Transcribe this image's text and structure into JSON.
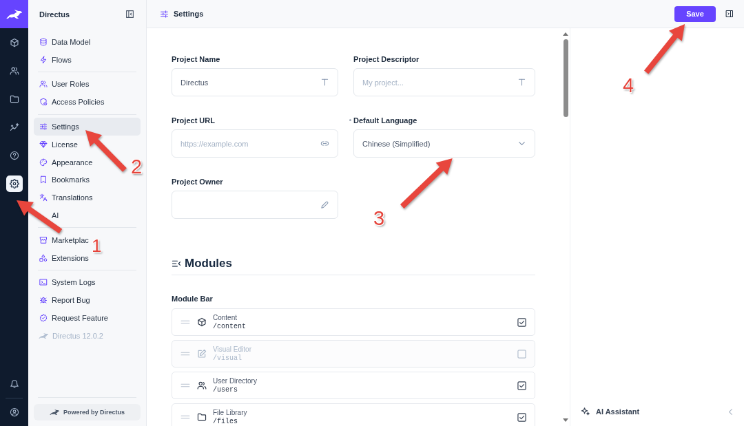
{
  "rail": {
    "items": [
      {
        "kind": "content",
        "selected": false
      },
      {
        "kind": "users",
        "selected": false
      },
      {
        "kind": "files",
        "selected": false
      },
      {
        "kind": "insights",
        "selected": false
      },
      {
        "kind": "help",
        "selected": false
      },
      {
        "kind": "settings",
        "selected": true
      }
    ],
    "bottom": [
      {
        "kind": "notifications"
      },
      {
        "kind": "profile"
      }
    ]
  },
  "sidebar": {
    "title": "Directus",
    "groups": [
      {
        "items": [
          {
            "label": "Data Model",
            "kind": "data-model",
            "selected": false
          },
          {
            "label": "Flows",
            "kind": "flows",
            "selected": false
          }
        ]
      },
      {
        "items": [
          {
            "label": "User Roles",
            "kind": "user-roles",
            "selected": false
          },
          {
            "label": "Access Policies",
            "kind": "access-policies",
            "selected": false
          }
        ]
      },
      {
        "items": [
          {
            "label": "Settings",
            "kind": "settings",
            "selected": true
          },
          {
            "label": "License",
            "kind": "license",
            "selected": false
          },
          {
            "label": "Appearance",
            "kind": "appearance",
            "selected": false
          },
          {
            "label": "Bookmarks",
            "kind": "bookmarks",
            "selected": false
          },
          {
            "label": "Translations",
            "kind": "translations",
            "selected": false
          },
          {
            "label": "AI",
            "selected": false
          }
        ]
      },
      {
        "items": [
          {
            "label": "Marketplac",
            "kind": "marketplace",
            "selected": false
          },
          {
            "label": "Extensions",
            "kind": "extensions",
            "selected": false
          }
        ]
      },
      {
        "items": [
          {
            "label": "System Logs",
            "kind": "system-logs",
            "selected": false
          },
          {
            "label": "Report Bug",
            "kind": "report-bug",
            "selected": false
          },
          {
            "label": "Request Feature",
            "kind": "request-feature",
            "selected": false
          },
          {
            "label": "Directus 12.0.2",
            "kind": "version",
            "selected": false
          }
        ]
      }
    ],
    "footer": "Powered by Directus"
  },
  "header": {
    "title": "Settings",
    "save_button": "Save"
  },
  "form": {
    "fields": [
      {
        "label": "Project Name",
        "kind": "text",
        "value": "Directus",
        "edited": false
      },
      {
        "label": "Project Descriptor",
        "kind": "text",
        "placeholder": "My project...",
        "edited": false
      },
      {
        "label": "Project URL",
        "kind": "url",
        "placeholder": "https://example.com",
        "edited": false
      },
      {
        "label": "Default Language",
        "kind": "select",
        "value": "Chinese (Simplified)",
        "edited": true
      },
      {
        "label": "Project Owner",
        "kind": "user",
        "edited": false
      }
    ]
  },
  "modules": {
    "title": "Modules",
    "bar_label": "Module Bar",
    "items": [
      {
        "name": "Content",
        "path": "/content",
        "kind": "content",
        "checked": true
      },
      {
        "name": "Visual Editor",
        "path": "/visual",
        "kind": "visual",
        "checked": false
      },
      {
        "name": "User Directory",
        "path": "/users",
        "kind": "users",
        "checked": true
      },
      {
        "name": "File Library",
        "path": "/files",
        "kind": "files",
        "checked": true
      }
    ]
  },
  "ai_panel": {
    "title": "AI Assistant"
  },
  "annotations": [
    {
      "number": "1"
    },
    {
      "number": "2"
    },
    {
      "number": "3"
    },
    {
      "number": "4"
    }
  ]
}
